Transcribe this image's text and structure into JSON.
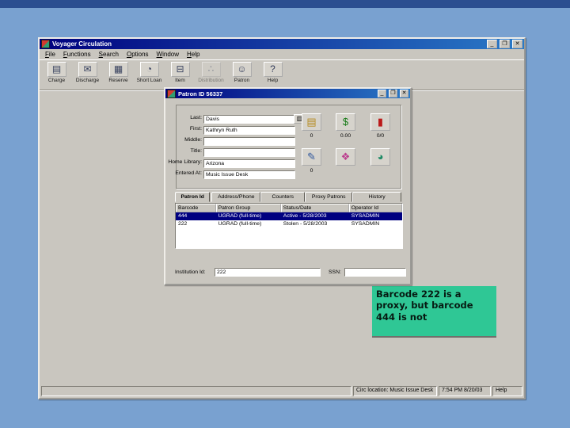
{
  "background": {
    "top_band_color": "#2b4e90",
    "slide_color": "#79a1d0"
  },
  "app": {
    "title": "Voyager Circulation",
    "titlebar_icons": {
      "minimize": "_",
      "maximize": "❒",
      "close": "✕"
    },
    "menu": [
      "File",
      "Functions",
      "Search",
      "Options",
      "Window",
      "Help"
    ],
    "toolbar": [
      {
        "label": "Charge",
        "icon": "▤"
      },
      {
        "label": "Discharge",
        "icon": "✉"
      },
      {
        "label": "Reserve",
        "icon": "▦"
      },
      {
        "label": "Short Loan",
        "icon": "◔"
      },
      {
        "label": "Item",
        "icon": "⊟"
      },
      {
        "label": "Distribution",
        "icon": "∴",
        "disabled": true
      },
      {
        "label": "Patron",
        "icon": "☺"
      },
      {
        "label": "Help",
        "icon": "?"
      }
    ],
    "statusbar": {
      "left": "",
      "location": "Circ location: Music Issue Desk",
      "datetime": "7:54 PM 8/20/03",
      "help": "Help"
    }
  },
  "dialog": {
    "title": "Patron ID 56337",
    "titlebar_icons": {
      "minimize": "_",
      "maximize": "❒",
      "close": "✕"
    },
    "fields": [
      {
        "label": "Last:",
        "value": "Davis"
      },
      {
        "label": "First:",
        "value": "Kathryn Ruth"
      },
      {
        "label": "Middle:",
        "value": ""
      },
      {
        "label": "Title:",
        "value": ""
      },
      {
        "label": "Home Library:",
        "value": "Arizona"
      },
      {
        "label": "Entered At:",
        "value": "Music Issue Desk"
      }
    ],
    "lookup_button_icon": "▥",
    "counters": [
      {
        "name": "charged-items",
        "icon": "▤",
        "color": "#b58a1e",
        "count": "0"
      },
      {
        "name": "fines-fees",
        "icon": "$",
        "color": "#157a15",
        "count": "0.00"
      },
      {
        "name": "overdue-recalls",
        "icon": "▮",
        "color": "#bb1a1a",
        "count": "0/0"
      },
      {
        "name": "notes",
        "icon": "✎",
        "color": "#31589c",
        "count": "0"
      },
      {
        "name": "stamps",
        "icon": "❖",
        "color": "#bb3f8e",
        "count": ""
      },
      {
        "name": "statistics",
        "icon": "◕",
        "color": "#1d8a64",
        "count": ""
      }
    ],
    "tabs": [
      {
        "label": "Patron Id"
      },
      {
        "label": "Address/Phone"
      },
      {
        "label": "Counters"
      },
      {
        "label": "Proxy Patrons"
      },
      {
        "label": "History"
      }
    ],
    "table": {
      "headers": [
        "Barcode",
        "Patron Group",
        "Status/Date",
        "Operator Id"
      ],
      "rows": [
        {
          "cells": [
            "444",
            "UGRAD (full-time)",
            "Active - 5/28/2003",
            "SYSADMIN"
          ]
        },
        {
          "cells": [
            "222",
            "UGRAD (full-time)",
            "Stolen - 5/28/2003",
            "SYSADMIN"
          ]
        }
      ]
    },
    "bottom": {
      "institution_label": "Institution Id:",
      "institution_value": "222",
      "ssn_label": "SSN:",
      "ssn_value": ""
    }
  },
  "annotation": {
    "text": "Barcode 222 is a proxy, but barcode 444 is not",
    "bg_color": "#2fc795"
  }
}
